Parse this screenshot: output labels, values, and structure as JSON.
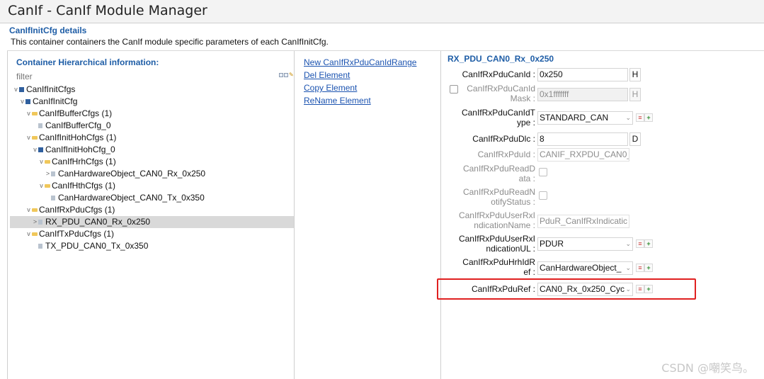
{
  "window": {
    "title": "CanIf - CanIf Module Manager"
  },
  "details": {
    "header": "CanIfInitCfg details",
    "description": "This container containers the CanIf module specific parameters of each CanIfInitCfg."
  },
  "tree": {
    "heading": "Container Hierarchical information:",
    "filter_placeholder": "filter",
    "items": [
      {
        "label": "CanIfInitCfgs",
        "expander": "v",
        "icon": "node"
      },
      {
        "label": "CanIfInitCfg",
        "expander": "v",
        "icon": "node"
      },
      {
        "label": "CanIfBufferCfgs (1)",
        "expander": "v",
        "icon": "folder"
      },
      {
        "label": "CanIfBufferCfg_0",
        "expander": "",
        "icon": "leaf"
      },
      {
        "label": "CanIfInitHohCfgs (1)",
        "expander": "v",
        "icon": "folder"
      },
      {
        "label": "CanIfInitHohCfg_0",
        "expander": "v",
        "icon": "node"
      },
      {
        "label": "CanIfHrhCfgs (1)",
        "expander": "v",
        "icon": "folder"
      },
      {
        "label": "CanHardwareObject_CAN0_Rx_0x250",
        "expander": ">",
        "icon": "leaf"
      },
      {
        "label": "CanIfHthCfgs (1)",
        "expander": "v",
        "icon": "folder"
      },
      {
        "label": "CanHardwareObject_CAN0_Tx_0x350",
        "expander": "",
        "icon": "leaf"
      },
      {
        "label": "CanIfRxPduCfgs (1)",
        "expander": "v",
        "icon": "folder"
      },
      {
        "label": "RX_PDU_CAN0_Rx_0x250",
        "expander": ">",
        "icon": "leaf",
        "selected": true
      },
      {
        "label": "CanIfTxPduCfgs (1)",
        "expander": "v",
        "icon": "folder"
      },
      {
        "label": "TX_PDU_CAN0_Tx_0x350",
        "expander": "",
        "icon": "leaf"
      }
    ]
  },
  "links": [
    "New CanIfRxPduCanIdRange",
    "Del Element",
    "Copy Element",
    "ReName Element"
  ],
  "form": {
    "heading": "RX_PDU_CAN0_Rx_0x250",
    "fields": {
      "can_id": {
        "label": "CanIfRxPduCanId :",
        "value": "0x250",
        "unit": "H"
      },
      "can_id_mask": {
        "label_1": "CanIfRxPduCanId",
        "label_2": "Mask :",
        "value": "0x1fffffff",
        "unit": "H"
      },
      "can_id_type": {
        "label_1": "CanIfRxPduCanIdT",
        "label_2": "ype :",
        "value": "STANDARD_CAN"
      },
      "dlc": {
        "label": "CanIfRxPduDlc :",
        "value": "8",
        "unit": "D"
      },
      "pdu_id": {
        "label": "CanIfRxPduId :",
        "value": "CANIF_RXPDU_CAN0_"
      },
      "read_data": {
        "label_1": "CanIfRxPduReadD",
        "label_2": "ata :"
      },
      "read_notify": {
        "label_1": "CanIfRxPduReadN",
        "label_2": "otifyStatus :"
      },
      "user_ind_name": {
        "label_1": "CanIfRxPduUserRxI",
        "label_2": "ndicationName :",
        "value": "PduR_CanIfRxIndicatic"
      },
      "user_ind_ul": {
        "label_1": "CanIfRxPduUserRxI",
        "label_2": "ndicationUL :",
        "value": "PDUR"
      },
      "hrh_ref": {
        "label_1": "CanIfRxPduHrhIdR",
        "label_2": "ef :",
        "value": "CanHardwareObject_"
      },
      "pdu_ref": {
        "label": "CanIfRxPduRef :",
        "value": "CAN0_Rx_0x250_Cyc"
      }
    }
  },
  "watermark": "CSDN @嘲笑鸟。",
  "colors": {
    "accent": "#1e5da6",
    "link": "#1b53b0",
    "highlight": "#e02020",
    "selection": "#d9d9d9"
  }
}
